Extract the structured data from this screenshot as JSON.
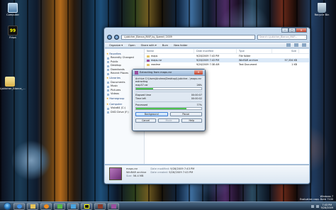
{
  "desktop": {
    "icons": [
      {
        "label": "Computer"
      },
      {
        "label": "Fraps"
      },
      {
        "label": "Ljubicher_Bianca_..."
      },
      {
        "label": "Recycle Bin"
      }
    ],
    "watermark": {
      "line1": "Windows 7",
      "line2": "Evaluation copy. Build 7100"
    }
  },
  "explorer": {
    "address": "Ljubicher_Bianca_MAP_by_Speed / 2009",
    "search_placeholder": "Search Ljubicher_Bianca_MAP...",
    "toolbar": {
      "organize": "Organize ▾",
      "open": "Open",
      "share": "Share with ▾",
      "burn": "Burn",
      "new_folder": "New folder"
    },
    "nav": {
      "favorites": "Favorites",
      "fav_items": [
        "Recently Changed",
        "Public",
        "Desktop",
        "Downloads",
        "Recent Places"
      ],
      "libraries": "Libraries",
      "lib_items": [
        "Documents",
        "Music",
        "Pictures",
        "Videos"
      ],
      "homegroup": "Homegroup",
      "computer": "Computer",
      "comp_items": [
        "Vista64 (C:)",
        "DVD Drive (F:)"
      ]
    },
    "columns": {
      "name": "Name",
      "date": "Date modified",
      "type": "Type",
      "size": "Size"
    },
    "files": [
      {
        "name": "maps",
        "date": "9/28/2009 7:43 PM",
        "type": "File folder",
        "size": ""
      },
      {
        "name": "maps.rar",
        "date": "9/28/2009 7:43 PM",
        "type": "WinRAR archive",
        "size": "57,334 KB"
      },
      {
        "name": "readme",
        "date": "9/26/2009 7:38 AM",
        "type": "Text Document",
        "size": "1 KB"
      }
    ],
    "details": {
      "name": "maps.rar",
      "type": "WinRAR archive",
      "modified_label": "Date modified:",
      "modified": "9/28/2009 7:43 PM",
      "created_label": "Date created:",
      "created": "9/28/2009 7:43 PM",
      "size_label": "Size:",
      "size": "56.4 MB"
    }
  },
  "dialog": {
    "title": "Extracting from maps.rar",
    "archive": "Archive C:\\Users\\Andrew\\Desktop\\Ljubicher...\\maps.rar",
    "extracting": "extracting",
    "file": "map37.rar",
    "file_pct": "26%",
    "file_progress": 0.26,
    "elapsed_label": "Elapsed time",
    "elapsed": "00:00:07",
    "left_label": "Time left",
    "left": "00:00:02",
    "processed_label": "Processed",
    "processed_pct": "77%",
    "processed_progress": 0.77,
    "buttons": {
      "background": "Background",
      "pause": "Pause",
      "cancel": "Cancel",
      "mode": "Mode",
      "help": "Help"
    }
  },
  "taskbar": {
    "time": "7:43 PM",
    "date": "9/28/2009"
  }
}
